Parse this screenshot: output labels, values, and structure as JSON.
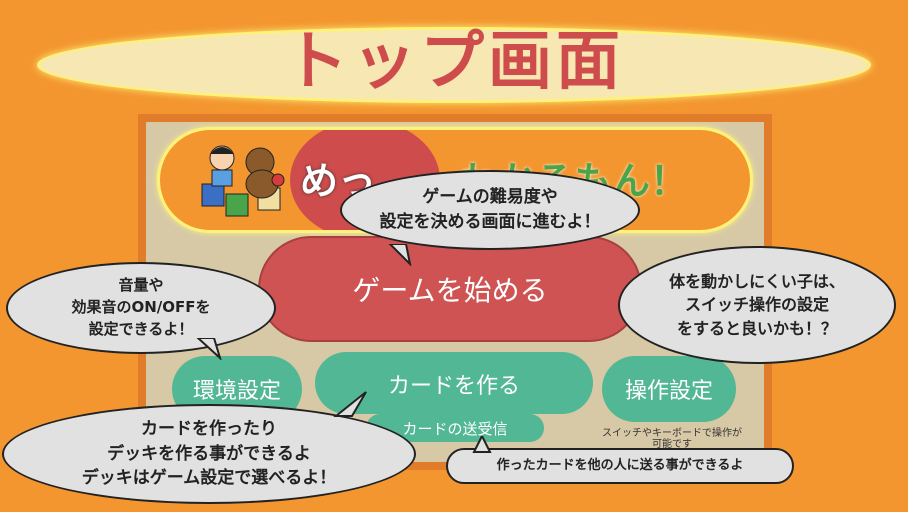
{
  "title": "トップ画面",
  "logo": {
    "left_text": "めっ",
    "right_text": "わかるもん！",
    "mascot": "boy-and-bear-mascot"
  },
  "buttons": {
    "start": "ゲームを始める",
    "env": "環境設定",
    "card": "カードを作る",
    "send": "カードの送受信",
    "op": "操作設定"
  },
  "op_note": "スイッチやキーボードで操作が可能です",
  "bubbles": {
    "start": [
      "ゲームの難易度や",
      "設定を決める画面に進むよ！"
    ],
    "sound": [
      "音量や",
      "効果音のON/OFFを",
      "設定できるよ！"
    ],
    "op": [
      "体を動かしにくい子は、",
      "スイッチ操作の設定",
      "をすると良いかも！？"
    ],
    "card": [
      "カードを作ったり",
      "デッキを作る事ができるよ",
      "デッキはゲーム設定で選べるよ！"
    ],
    "send": "作ったカードを他の人に送る事ができるよ"
  },
  "colors": {
    "background": "#f3962f",
    "accent_red": "#cf5353",
    "accent_green": "#52b794",
    "panel": "#d7c9a6"
  }
}
